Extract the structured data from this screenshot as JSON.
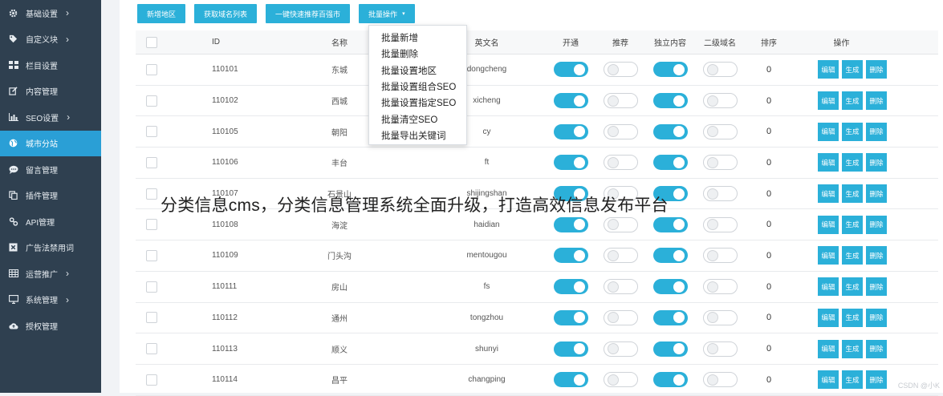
{
  "sidebar": {
    "items": [
      {
        "label": "基础设置",
        "icon": "gear-icon",
        "has_submenu": true,
        "active": false
      },
      {
        "label": "自定义块",
        "icon": "tag-icon",
        "has_submenu": true,
        "active": false
      },
      {
        "label": "栏目设置",
        "icon": "grid-icon",
        "has_submenu": false,
        "active": false
      },
      {
        "label": "内容管理",
        "icon": "edit-icon",
        "has_submenu": false,
        "active": false
      },
      {
        "label": "SEO设置",
        "icon": "bar-chart-icon",
        "has_submenu": true,
        "active": false
      },
      {
        "label": "城市分站",
        "icon": "globe-icon",
        "has_submenu": false,
        "active": true
      },
      {
        "label": "留言管理",
        "icon": "comment-icon",
        "has_submenu": false,
        "active": false
      },
      {
        "label": "插件管理",
        "icon": "copy-icon",
        "has_submenu": false,
        "active": false
      },
      {
        "label": "API管理",
        "icon": "link-icon",
        "has_submenu": false,
        "active": false
      },
      {
        "label": "广告法禁用词",
        "icon": "close-square-icon",
        "has_submenu": false,
        "active": false
      },
      {
        "label": "运营推广",
        "icon": "table-icon",
        "has_submenu": true,
        "active": false
      },
      {
        "label": "系统管理",
        "icon": "monitor-icon",
        "has_submenu": true,
        "active": false
      },
      {
        "label": "授权管理",
        "icon": "cloud-upload-icon",
        "has_submenu": false,
        "active": false
      }
    ]
  },
  "toolbar": {
    "add_region": "新增地区",
    "fetch_domains": "获取域名列表",
    "push_baidu": "一键快速推荐百强市",
    "batch_ops": "批量操作",
    "batch_caret": "▾"
  },
  "dropdown": {
    "items": [
      "批量新增",
      "批量删除",
      "批量设置地区",
      "批量设置组合SEO",
      "批量设置指定SEO",
      "批量清空SEO",
      "批量导出关键词"
    ]
  },
  "table": {
    "headers": {
      "id": "ID",
      "name": "名称",
      "en_name": "英文名",
      "enabled": "开通",
      "recommend": "推荐",
      "standalone": "独立内容",
      "subdomain": "二级域名",
      "sort": "排序",
      "actions": "操作"
    },
    "action_labels": {
      "edit": "编辑",
      "generate": "生成",
      "delete": "删除"
    },
    "rows": [
      {
        "id": "110101",
        "name": "东城",
        "en": "dongcheng",
        "enabled": true,
        "recommend": false,
        "standalone": true,
        "subdomain": false,
        "sort": "0"
      },
      {
        "id": "110102",
        "name": "西城",
        "en": "xicheng",
        "enabled": true,
        "recommend": false,
        "standalone": true,
        "subdomain": false,
        "sort": "0"
      },
      {
        "id": "110105",
        "name": "朝阳",
        "en": "cy",
        "enabled": true,
        "recommend": false,
        "standalone": true,
        "subdomain": false,
        "sort": "0"
      },
      {
        "id": "110106",
        "name": "丰台",
        "en": "ft",
        "enabled": true,
        "recommend": false,
        "standalone": true,
        "subdomain": false,
        "sort": "0"
      },
      {
        "id": "110107",
        "name": "石景山",
        "en": "shijingshan",
        "enabled": true,
        "recommend": false,
        "standalone": true,
        "subdomain": false,
        "sort": "0"
      },
      {
        "id": "110108",
        "name": "海淀",
        "en": "haidian",
        "enabled": true,
        "recommend": false,
        "standalone": true,
        "subdomain": false,
        "sort": "0"
      },
      {
        "id": "110109",
        "name": "门头沟",
        "en": "mentougou",
        "enabled": true,
        "recommend": false,
        "standalone": true,
        "subdomain": false,
        "sort": "0"
      },
      {
        "id": "110111",
        "name": "房山",
        "en": "fs",
        "enabled": true,
        "recommend": false,
        "standalone": true,
        "subdomain": false,
        "sort": "0"
      },
      {
        "id": "110112",
        "name": "通州",
        "en": "tongzhou",
        "enabled": true,
        "recommend": false,
        "standalone": true,
        "subdomain": false,
        "sort": "0"
      },
      {
        "id": "110113",
        "name": "顺义",
        "en": "shunyi",
        "enabled": true,
        "recommend": false,
        "standalone": true,
        "subdomain": false,
        "sort": "0"
      },
      {
        "id": "110114",
        "name": "昌平",
        "en": "changping",
        "enabled": true,
        "recommend": false,
        "standalone": true,
        "subdomain": false,
        "sort": "0"
      }
    ]
  },
  "overlay_caption": "分类信息cms，分类信息管理系统全面升级，打造高效信息发布平台",
  "watermark": "CSDN @小K",
  "colors": {
    "sidebar_bg": "#2f4050",
    "accent": "#2bb0d9",
    "active_item": "#2a9fd6"
  }
}
